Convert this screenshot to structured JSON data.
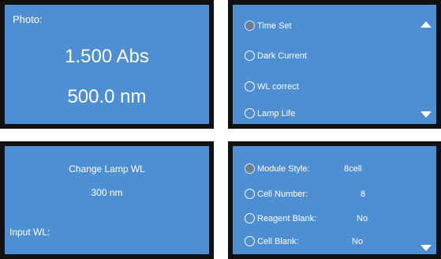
{
  "measure_panel": {
    "label": "Photo:",
    "absorbance": "1.500 Abs",
    "wavelength": "500.0 nm"
  },
  "settings_menu": {
    "items": [
      {
        "label": "Time Set",
        "selected": true
      },
      {
        "label": "Dark Current",
        "selected": false
      },
      {
        "label": "WL correct",
        "selected": false
      },
      {
        "label": "Lamp Life",
        "selected": false
      }
    ],
    "scroll_up_icon": "triangle-up",
    "scroll_down_icon": "triangle-down"
  },
  "lamp_panel": {
    "title": "Change Lamp WL",
    "value": "300 nm",
    "input_label": "Input WL:"
  },
  "module_menu": {
    "items": [
      {
        "label": "Module Style:",
        "value": "8cell",
        "selected": true
      },
      {
        "label": "Cell Number:",
        "value": "8",
        "selected": false
      },
      {
        "label": "Reagent Blank:",
        "value": "No",
        "selected": false
      },
      {
        "label": "Cell Blank:",
        "value": "No",
        "selected": false
      }
    ],
    "scroll_down_icon": "triangle-down"
  },
  "colors": {
    "panel_bg": "#4e8fd3",
    "panel_border": "#111111",
    "text": "#ffffff",
    "selected_radio": "#6b7e93"
  }
}
